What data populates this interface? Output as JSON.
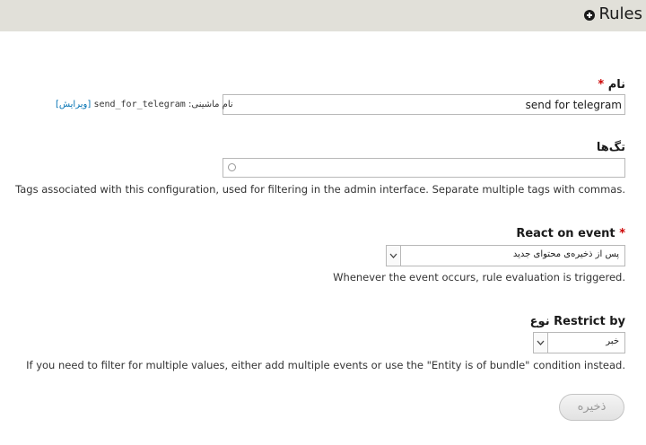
{
  "header": {
    "title": "Rules"
  },
  "name_field": {
    "label": "نام",
    "required_mark": "*",
    "value": "send for telegram",
    "machine_name_label": "نام ماشینی:",
    "machine_name_value": "send_for_telegram",
    "edit_link": "[ویرایش]"
  },
  "tags_field": {
    "label": "تگ‌ها",
    "value": "",
    "description": "Tags associated with this configuration, used for filtering in the admin interface. Separate multiple tags with commas."
  },
  "event_field": {
    "label": "React on event",
    "required_mark": "*",
    "selected": "پس از ذخیره‌ی محتوای جدید",
    "description": "Whenever the event occurs, rule evaluation is triggered."
  },
  "restrict_field": {
    "label": "Restrict by نوع",
    "selected": "خبر",
    "description": "If you need to filter for multiple values, either add multiple events or use the \"Entity is of bundle\" condition instead."
  },
  "save_button": {
    "label": "ذخیره"
  }
}
